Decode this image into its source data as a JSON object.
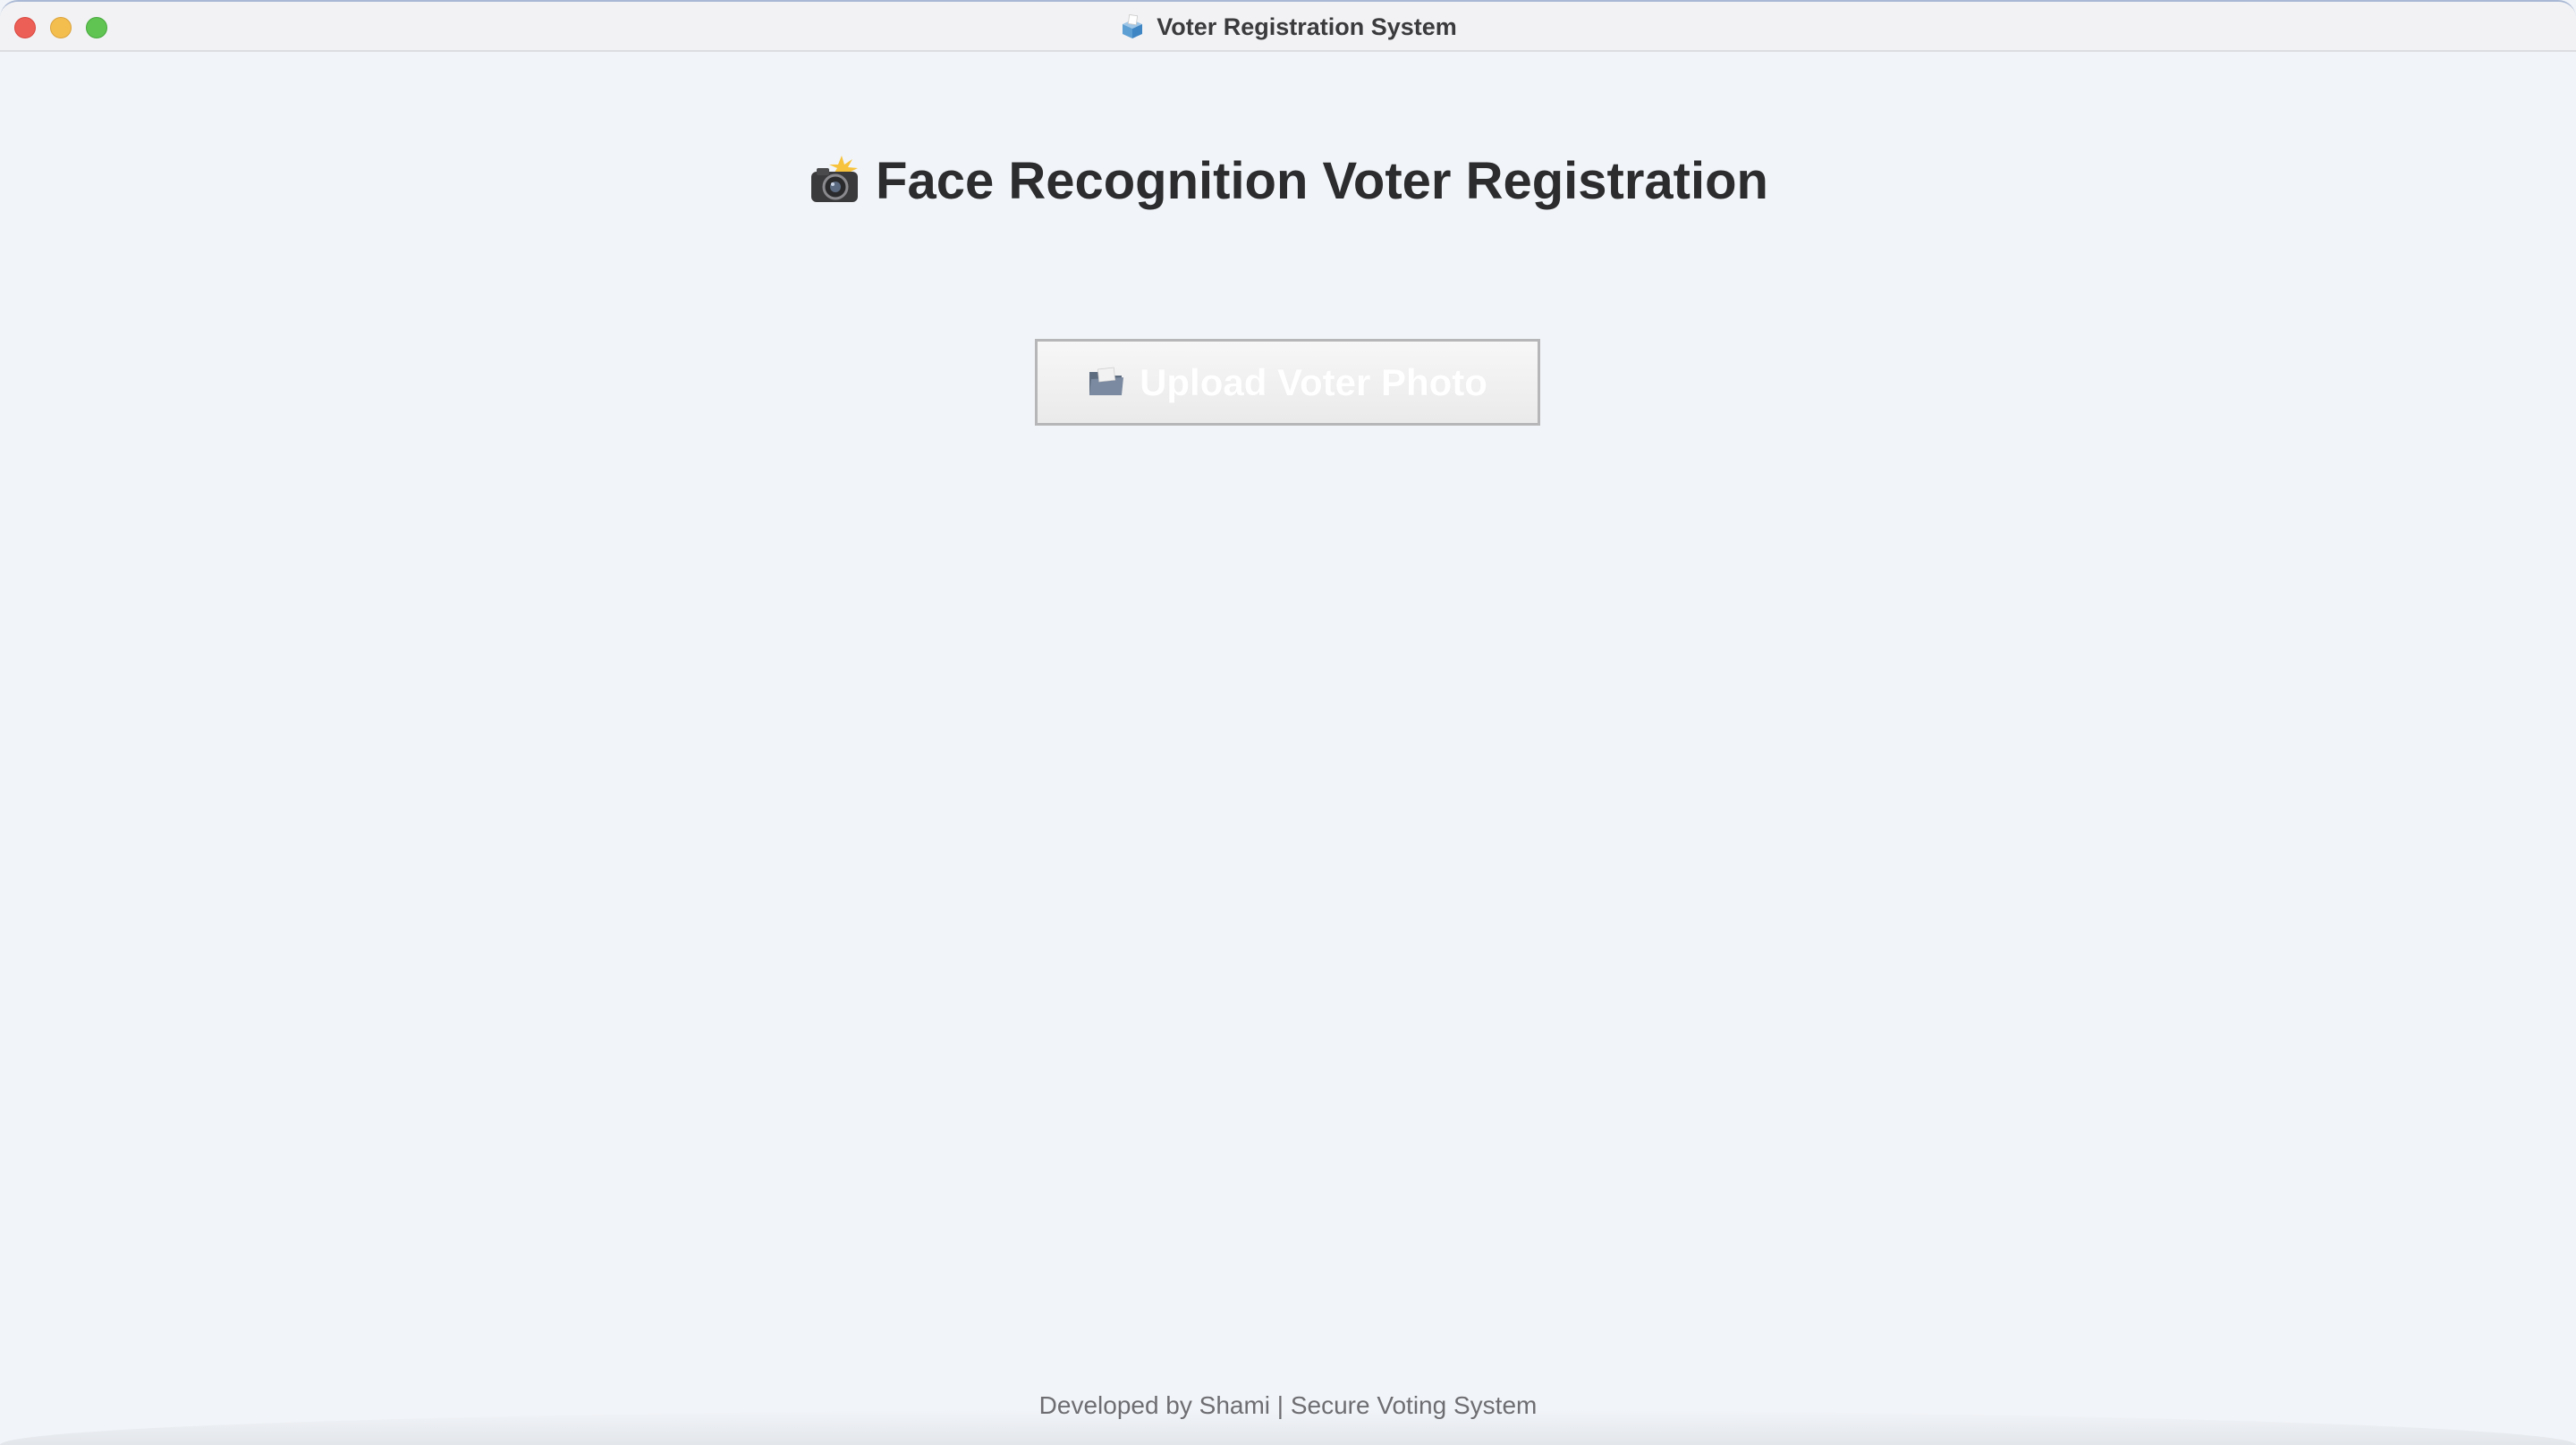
{
  "window": {
    "title": "Voter Registration System",
    "title_icon": "ballot-box-icon"
  },
  "main": {
    "heading": "Face Recognition Voter Registration",
    "heading_icon": "camera-flash-icon",
    "upload_button": {
      "label": "Upload Voter Photo",
      "icon": "folder-icon"
    }
  },
  "footer": {
    "text": "Developed by Shami | Secure Voting System"
  },
  "colors": {
    "background": "#f1f4f8",
    "heading_text": "#2c2c2e",
    "footer_text": "#6e6e72",
    "button_label": "#ffffff",
    "close": "#ec5f57",
    "minimize": "#f4be4f",
    "maximize": "#5fc452"
  }
}
